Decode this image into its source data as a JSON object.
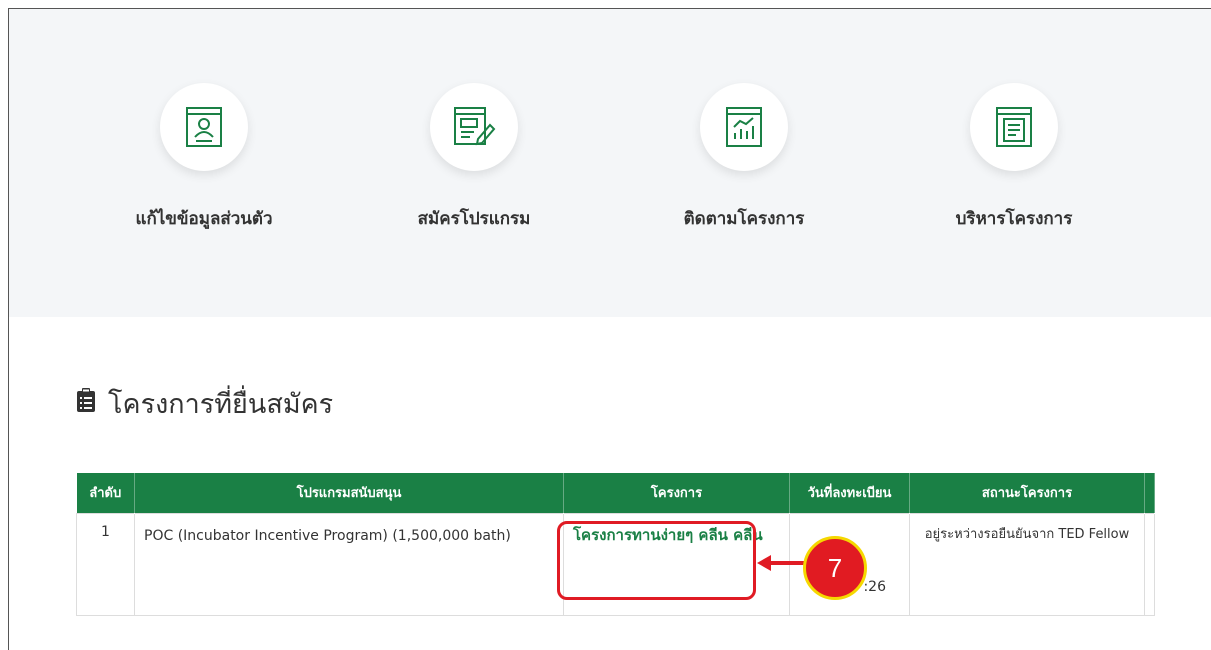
{
  "menu": {
    "items": [
      {
        "label": "แก้ไขข้อมูลส่วนตัว",
        "icon": "profile-card-icon"
      },
      {
        "label": "สมัครโปรแกรม",
        "icon": "edit-form-icon"
      },
      {
        "label": "ติดตามโครงการ",
        "icon": "chart-window-icon"
      },
      {
        "label": "บริหารโครงการ",
        "icon": "document-window-icon"
      }
    ]
  },
  "section": {
    "title": "โครงการที่ยื่นสมัคร",
    "icon": "clipboard-icon"
  },
  "table": {
    "headers": [
      "ลำดับ",
      "โปรแกรมสนับสนุน",
      "โครงการ",
      "วันที่ลงทะเบียน",
      "สถานะโครงการ"
    ],
    "rows": [
      {
        "no": "1",
        "program": "POC (Incubator Incentive Program) (1,500,000 bath)",
        "project": "โครงการทานง่ายๆ คลีน คลีน",
        "date_visible": ":26",
        "status": "อยู่ระหว่างรอยืนยันจาก TED Fellow"
      }
    ]
  },
  "annotation": {
    "step": "7"
  },
  "colors": {
    "primary_green": "#1a8045",
    "highlight_red": "#e01b24",
    "badge_yellow": "#f5d800"
  }
}
